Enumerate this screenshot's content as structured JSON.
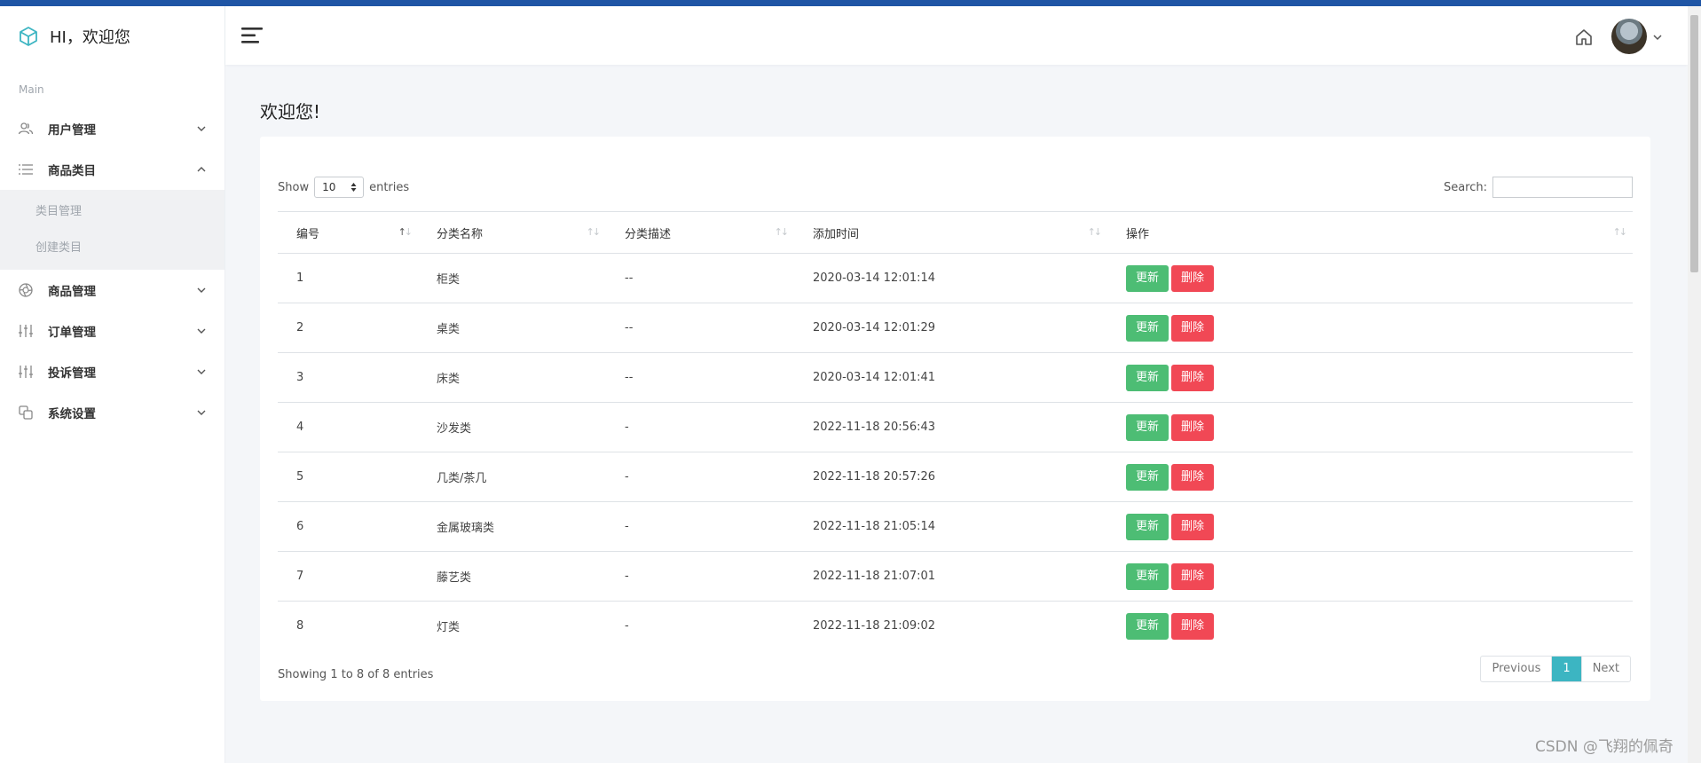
{
  "brand": {
    "title": "HI，欢迎您",
    "accent": "#3cb5c2"
  },
  "sidebar": {
    "section_label": "Main",
    "items": [
      {
        "label": "用户管理",
        "icon": "users-icon",
        "expanded": false
      },
      {
        "label": "商品类目",
        "icon": "list-icon",
        "expanded": true,
        "children": [
          {
            "label": "类目管理"
          },
          {
            "label": "创建类目"
          }
        ]
      },
      {
        "label": "商品管理",
        "icon": "aperture-icon",
        "expanded": false
      },
      {
        "label": "订单管理",
        "icon": "sliders-icon",
        "expanded": false
      },
      {
        "label": "投诉管理",
        "icon": "sliders-icon",
        "expanded": false
      },
      {
        "label": "系统设置",
        "icon": "copy-icon",
        "expanded": false
      }
    ]
  },
  "header": {
    "menu_icon": "hamburger-icon",
    "home_icon": "home-icon",
    "avatar_icon": "avatar"
  },
  "page": {
    "title": "欢迎您!"
  },
  "table_controls": {
    "show_label": "Show",
    "entries_value": "10",
    "entries_label": "entries",
    "search_label": "Search:",
    "search_value": ""
  },
  "table": {
    "headers": [
      "编号",
      "分类名称",
      "分类描述",
      "添加时间",
      "操作"
    ],
    "rows": [
      {
        "id": "1",
        "name": "柜类",
        "desc": "--",
        "time": "2020-03-14 12:01:14"
      },
      {
        "id": "2",
        "name": "桌类",
        "desc": "--",
        "time": "2020-03-14 12:01:29"
      },
      {
        "id": "3",
        "name": "床类",
        "desc": "--",
        "time": "2020-03-14 12:01:41"
      },
      {
        "id": "4",
        "name": "沙发类",
        "desc": "-",
        "time": "2022-11-18 20:56:43"
      },
      {
        "id": "5",
        "name": "几类/茶几",
        "desc": "-",
        "time": "2022-11-18 20:57:26"
      },
      {
        "id": "6",
        "name": "金属玻璃类",
        "desc": "-",
        "time": "2022-11-18 21:05:14"
      },
      {
        "id": "7",
        "name": "藤艺类",
        "desc": "-",
        "time": "2022-11-18 21:07:01"
      },
      {
        "id": "8",
        "name": "灯类",
        "desc": "-",
        "time": "2022-11-18 21:09:02"
      }
    ],
    "update_label": "更新",
    "delete_label": "删除",
    "update_color": "#4dbd74",
    "delete_color": "#f14855"
  },
  "footer": {
    "info": "Showing 1 to 8 of 8 entries",
    "prev": "Previous",
    "current_page": "1",
    "next": "Next"
  },
  "watermark": "CSDN @飞翔的佩奇"
}
